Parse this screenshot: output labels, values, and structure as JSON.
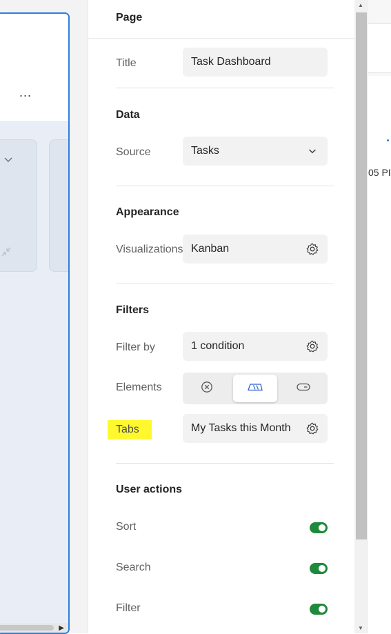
{
  "canvas": {
    "more_label": "..."
  },
  "panel": {
    "page": {
      "section_title": "Page",
      "title_label": "Title",
      "title_value": "Task Dashboard"
    },
    "data": {
      "section_title": "Data",
      "source_label": "Source",
      "source_value": "Tasks"
    },
    "appearance": {
      "section_title": "Appearance",
      "visualizations_label": "Visualizations",
      "visualizations_value": "Kanban"
    },
    "filters": {
      "section_title": "Filters",
      "filter_by_label": "Filter by",
      "filter_by_value": "1 condition",
      "elements_label": "Elements",
      "tabs_label": "Tabs",
      "tabs_value": "My Tasks this Month"
    },
    "user_actions": {
      "section_title": "User actions",
      "items": [
        {
          "label": "Sort",
          "enabled": true
        },
        {
          "label": "Search",
          "enabled": true
        },
        {
          "label": "Filter",
          "enabled": true
        }
      ]
    }
  },
  "right_app": {
    "partial_time": "05 PI"
  },
  "colors": {
    "accent": "#2f7de1",
    "toggle_on": "#1f8a3b",
    "highlight": "#fff82e"
  },
  "icons": {
    "field_settings": "gear-icon",
    "dropdown": "chevron-down-icon",
    "element_options": [
      "close-circle-icon",
      "tab-strip-icon",
      "toggle-pill-icon"
    ]
  }
}
